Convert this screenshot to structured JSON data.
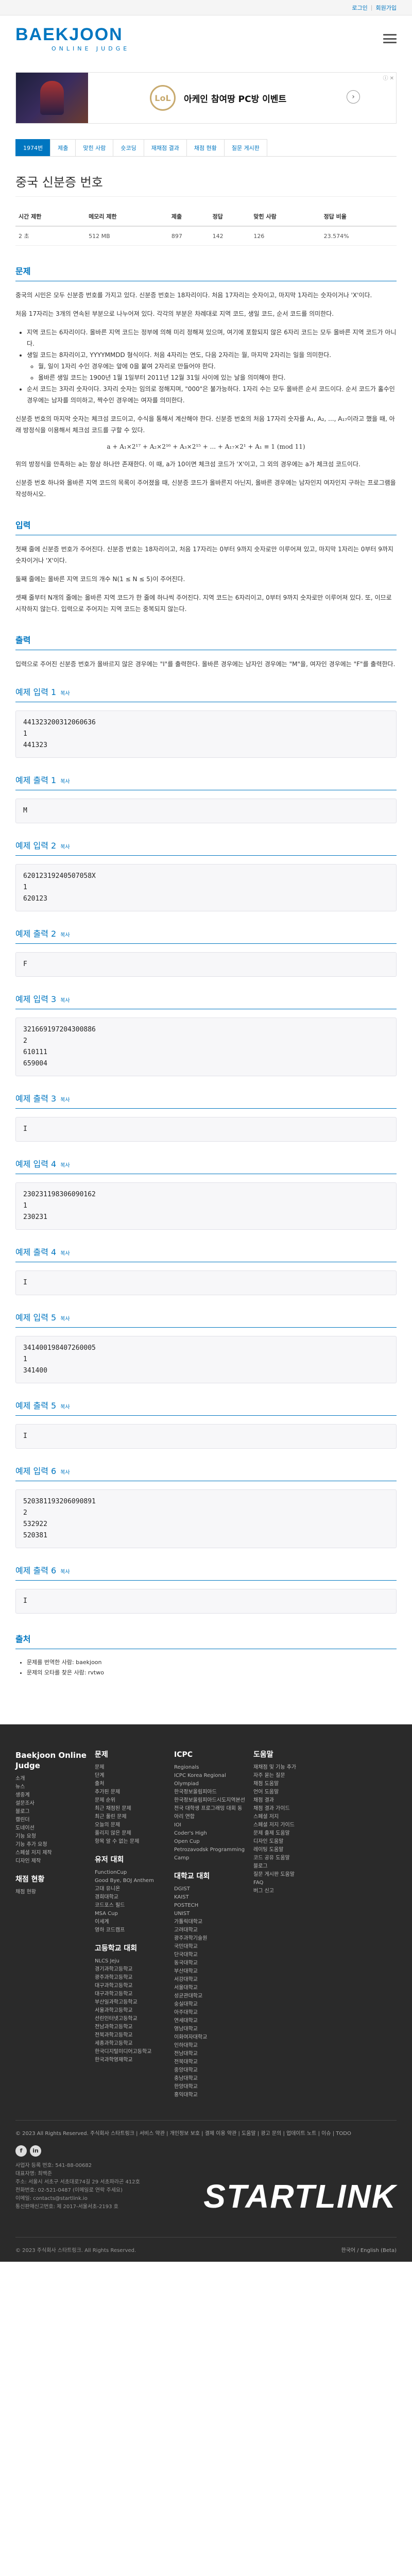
{
  "topbar": {
    "login": "로그인",
    "signup": "회원가입"
  },
  "logo": {
    "main": "BAEKJOON",
    "sub": "ONLINE JUDGE"
  },
  "ad": {
    "logo_text": "LoL",
    "text": "아케인 참여땅 PC방 이벤트",
    "close": "ⓘ ✕"
  },
  "tabs": [
    "1974번",
    "제출",
    "맞힌 사람",
    "숏코딩",
    "재채점 결과",
    "채점 현황",
    "질문 게시판"
  ],
  "problem": {
    "title": "중국 신분증 번호",
    "info_headers": [
      "시간 제한",
      "메모리 제한",
      "제출",
      "정답",
      "맞힌 사람",
      "정답 비율"
    ],
    "info_values": [
      "2 초",
      "512 MB",
      "897",
      "142",
      "126",
      "23.574%"
    ]
  },
  "description": {
    "title": "문제",
    "p1": "중국의 시민은 모두 신분증 번호를 가지고 있다. 신분증 번호는 18자리이다. 처음 17자리는 숫자이고, 마지막 1자리는 숫자이거나 'X'이다.",
    "p2": "처음 17자리는 3개의 연속된 부분으로 나누어져 있다. 각각의 부분은 차례대로 지역 코드, 생일 코드, 순서 코드를 의미한다.",
    "b1": "지역 코드는 6자리이다. 올바른 지역 코드는 정부에 의해 미리 정해져 있으며, 여기에 포함되지 않은 6자리 코드는 모두 올바른 지역 코드가 아니다.",
    "b2": "생일 코드는 8자리이고, YYYYMMDD 형식이다. 처음 4자리는 연도, 다음 2자리는 월, 마지막 2자리는 일을 의미한다.",
    "b2a": "월, 일이 1자리 수인 경우에는 앞에 0을 붙여 2자리로 만들어야 한다.",
    "b2b": "올바른 생일 코드는 1900년 1월 1일부터 2011년 12월 31일 사이에 있는 날을 의미해야 한다.",
    "b3": "순서 코드는 3자리 숫자이다. 3자리 숫자는 임의로 정해지며, \"000\"은 불가능하다. 1자리 수는 모두 올바른 순서 코드이다. 순서 코드가 홀수인 경우에는 남자를 의미하고, 짝수인 경우에는 여자를 의미한다.",
    "p3": "신분증 번호의 마지막 숫자는 체크섬 코드이고, 수식을 통해서 계산해야 한다. 신분증 번호의 처음 17자리 숫자를 A₁, A₂, ..., A₁₇이라고 했을 때, 아래 방정식을 이용해서 체크섬 코드를 구할 수 있다.",
    "formula": "a + A₁×2¹⁷ + A₂×2¹⁶ + A₃×2¹⁵ + ... + A₁₇×2¹ + A₁ ≡ 1 (mod 11)",
    "p4": "위의 방정식을 만족하는 a는 항상 하나만 존재한다. 이 때, a가 10이면 체크섬 코드가 'X'이고, 그 외의 경우에는 a가 체크섬 코드이다.",
    "p5": "신분증 번호 하나와 올바른 지역 코드의 목록이 주어졌을 때, 신분증 코드가 올바른지 아닌지, 올바른 경우에는 남자인지 여자인지 구하는 프로그램을 작성하시오."
  },
  "input": {
    "title": "입력",
    "p1": "첫째 줄에 신분증 번호가 주어진다. 신분증 번호는 18자리이고, 처음 17자리는 0부터 9까지 숫자로만 이루어져 있고, 마지막 1자리는 0부터 9까지 숫자이거나 'X'이다.",
    "p2": "둘째 줄에는 올바른 지역 코드의 개수 N(1 ≤ N ≤ 5)이 주어진다.",
    "p3": "셋째 줄부터 N개의 줄에는 올바른 지역 코드가 한 줄에 하나씩 주어진다. 지역 코드는 6자리이고, 0부터 9까지 숫자로만 이루어져 있다. 또, 이므로 시작하지 않는다. 입력으로 주어지는 지역 코드는 중복되지 않는다."
  },
  "output": {
    "title": "출력",
    "p1": "입력으로 주어진 신분증 번호가 올바르지 않은 경우에는 \"I\"를 출력한다. 올바른 경우에는 남자인 경우에는 \"M\"을, 여자인 경우에는 \"F\"를 출력한다."
  },
  "copy_label": "복사",
  "samples": [
    {
      "in_title": "예제 입력 1",
      "input": "441323200312060636\n1\n441323",
      "out_title": "예제 출력 1",
      "output": "M"
    },
    {
      "in_title": "예제 입력 2",
      "input": "62012319240507058X\n1\n620123",
      "out_title": "예제 출력 2",
      "output": "F"
    },
    {
      "in_title": "예제 입력 3",
      "input": "321669197204300886\n2\n610111\n659004",
      "out_title": "예제 출력 3",
      "output": "I"
    },
    {
      "in_title": "예제 입력 4",
      "input": "230231198306090162\n1\n230231",
      "out_title": "예제 출력 4",
      "output": "I"
    },
    {
      "in_title": "예제 입력 5",
      "input": "341400198407260005\n1\n341400",
      "out_title": "예제 출력 5",
      "output": "I"
    },
    {
      "in_title": "예제 입력 6",
      "input": "520381193206090891\n2\n532922\n520381",
      "out_title": "예제 출력 6",
      "output": "I"
    }
  ],
  "source": {
    "title": "출처",
    "items": [
      "문제를 번역한 사람: baekjoon",
      "문제의 오타를 찾은 사람: rvtwo"
    ]
  },
  "footer": {
    "brand": "Baekjoon Online Judge",
    "col1": [
      "소개",
      "뉴스",
      "생중계",
      "설문조사",
      "블로그",
      "캘린더",
      "도네이션",
      "기능 요청",
      "기능 추가 요청",
      "스페셜 저지 제작",
      "디자인 제작"
    ],
    "col1b_title": "채점 현황",
    "col1b": [
      "채점 현황"
    ],
    "col2_title": "문제",
    "col2": [
      "문제",
      "단계",
      "출처",
      "추가된 문제",
      "문제 순위",
      "최근 채점된 문제",
      "최근 풀린 문제",
      "오늘의 문제",
      "풀리지 않은 문제",
      "항목 알 수 없는 문제"
    ],
    "col2b_title": "유저 대회",
    "col2b": [
      "FunctionCup",
      "Good Bye, BOJ Anthem",
      "고대 유니온",
      "경희대학교",
      "코드포스 필드",
      "MSA Cup",
      "이세계",
      "영하 코드캠프"
    ],
    "col2c_title": "고등학교 대회",
    "col2c": [
      "NLCS Jeju",
      "경기과학고등학교",
      "광주과학고등학교",
      "대구과학고등학교",
      "대구과학고등학교",
      "부산일과학고등학교",
      "서울과학고등학교",
      "선린인터넷고등학교",
      "전남과학고등학교",
      "전북과학고등학교",
      "세종과학고등학교",
      "한국디지털미디어고등학교",
      "한국과학영재학교"
    ],
    "col3_title": "ICPC",
    "col3": [
      "Regionals",
      "ICPC Korea Regional",
      "Olympiad",
      "한국정보올림피아드",
      "한국정보올림피아드시도지역본선",
      "전국 대학생 프로그래밍 대회 동아리 연합",
      "IOI",
      "Coder's High",
      "Open Cup",
      "Petrozavodsk Programming Camp"
    ],
    "col3b_title": "대학교 대회",
    "col3b": [
      "DGIST",
      "KAIST",
      "POSTECH",
      "UNIST",
      "가톨릭대학교",
      "고려대학교",
      "광주과학기술원",
      "국민대학교",
      "단국대학교",
      "동국대학교",
      "부산대학교",
      "서강대학교",
      "서울대학교",
      "성균관대학교",
      "숭실대학교",
      "아주대학교",
      "연세대학교",
      "영남대학교",
      "이화여자대학교",
      "인하대학교",
      "전남대학교",
      "전북대학교",
      "중앙대학교",
      "충남대학교",
      "한양대학교",
      "홍익대학교"
    ],
    "col4_title": "도움말",
    "col4": [
      "재채점 및 기능 추가",
      "자주 묻는 질문",
      "채점 도움말",
      "언어 도움말",
      "채점 결과",
      "채점 결과 가이드",
      "스페셜 저지",
      "스페셜 저지 가이드",
      "문제 출제 도움말",
      "디자인 도움말",
      "레이팅 도움말",
      "코드 공유 도움말",
      "블로그",
      "질문 게시판 도움말",
      "FAQ",
      "버그 신고"
    ],
    "bottom_links": "© 2023 All Rights Reserved. 주식회사 스타트링크 | 서비스 약관 | 개인정보 보호 | 결제 이용 약관 | 도움말 | 광고 문의 | 업데이트 노트 | 이슈 | TODO",
    "social": [
      "f",
      "in"
    ],
    "company": "사업자 등록 번호: 541-88-00682\n대표자명: 최백준\n주소: 서울시 서초구 서초대로74길 29 서초파라곤 412호\n전화번호: 02-521-0487 (이메일로 연락 주세요)\n이메일: contacts@startlink.io\n통신판매신고번호: 제 2017-서울서초-2193 호",
    "startlink": "STARTLINK",
    "copyright_left": "© 2023 주식회사 스타트링크. All Rights Reserved.",
    "copyright_right": "한국어 / English (Beta)"
  }
}
